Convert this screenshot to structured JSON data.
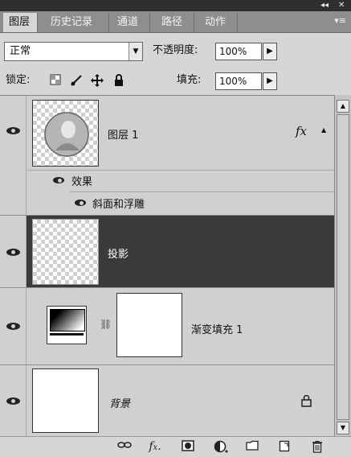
{
  "titlebar": {
    "collapse_label": "◂◂",
    "close_label": "✕"
  },
  "tabs": [
    {
      "label": "图层"
    },
    {
      "label": "历史记录"
    },
    {
      "label": "通道"
    },
    {
      "label": "路径"
    },
    {
      "label": "动作"
    }
  ],
  "tabs_menu": "▾≡",
  "blend_mode": {
    "value": "正常"
  },
  "opacity": {
    "label": "不透明度:",
    "value": "100%"
  },
  "lock": {
    "label": "锁定:"
  },
  "fill": {
    "label": "填充:",
    "value": "100%"
  },
  "layers": [
    {
      "name": "图层 1",
      "fx": "fx",
      "effects_label": "效果",
      "effect": "斜面和浮雕"
    },
    {
      "name": "投影",
      "selected": true
    },
    {
      "name": "渐变填充 1"
    },
    {
      "name": "背景",
      "locked": true
    }
  ],
  "colors": {
    "selected_row": "#3a3a3a",
    "panel_bg": "#d6d6d6",
    "tab_bar": "#8e8e8e"
  },
  "icons": [
    "link-icon",
    "fx-icon",
    "mask-icon",
    "adjustment-icon",
    "folder-icon",
    "new-layer-icon",
    "trash-icon"
  ]
}
